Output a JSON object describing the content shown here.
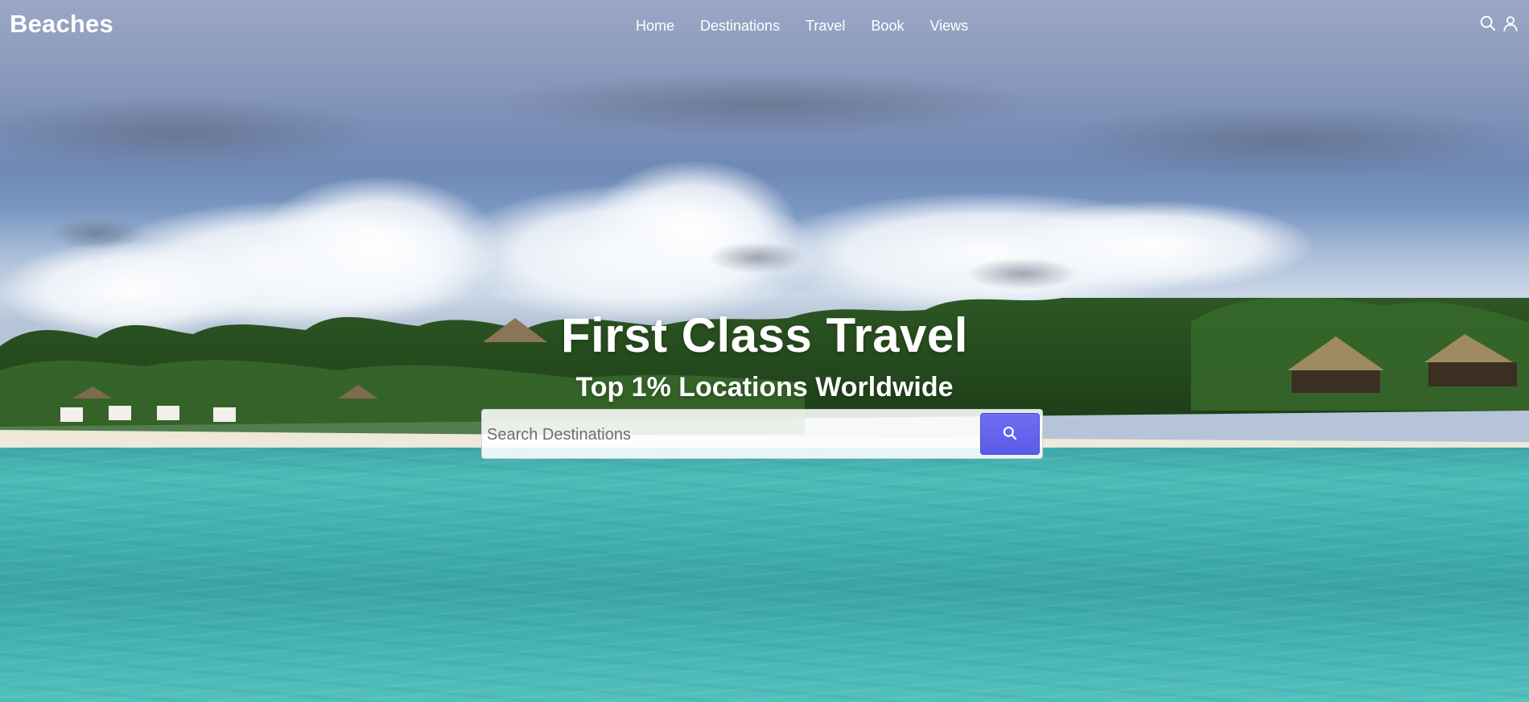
{
  "brand": {
    "logo_text": "Beaches"
  },
  "nav": {
    "items": [
      {
        "label": "Home"
      },
      {
        "label": "Destinations"
      },
      {
        "label": "Travel"
      },
      {
        "label": "Book"
      },
      {
        "label": "Views"
      }
    ]
  },
  "header_icons": [
    "search-icon",
    "user-icon"
  ],
  "hero": {
    "title": "First Class Travel",
    "subtitle": "Top 1% Locations Worldwide"
  },
  "search": {
    "placeholder": "Search Destinations",
    "value": "",
    "button_icon": "search-icon",
    "button_color": "#5f61ee"
  },
  "colors": {
    "sky": "#7f92b8",
    "sea": "#42b2b0",
    "text": "#ffffff"
  }
}
